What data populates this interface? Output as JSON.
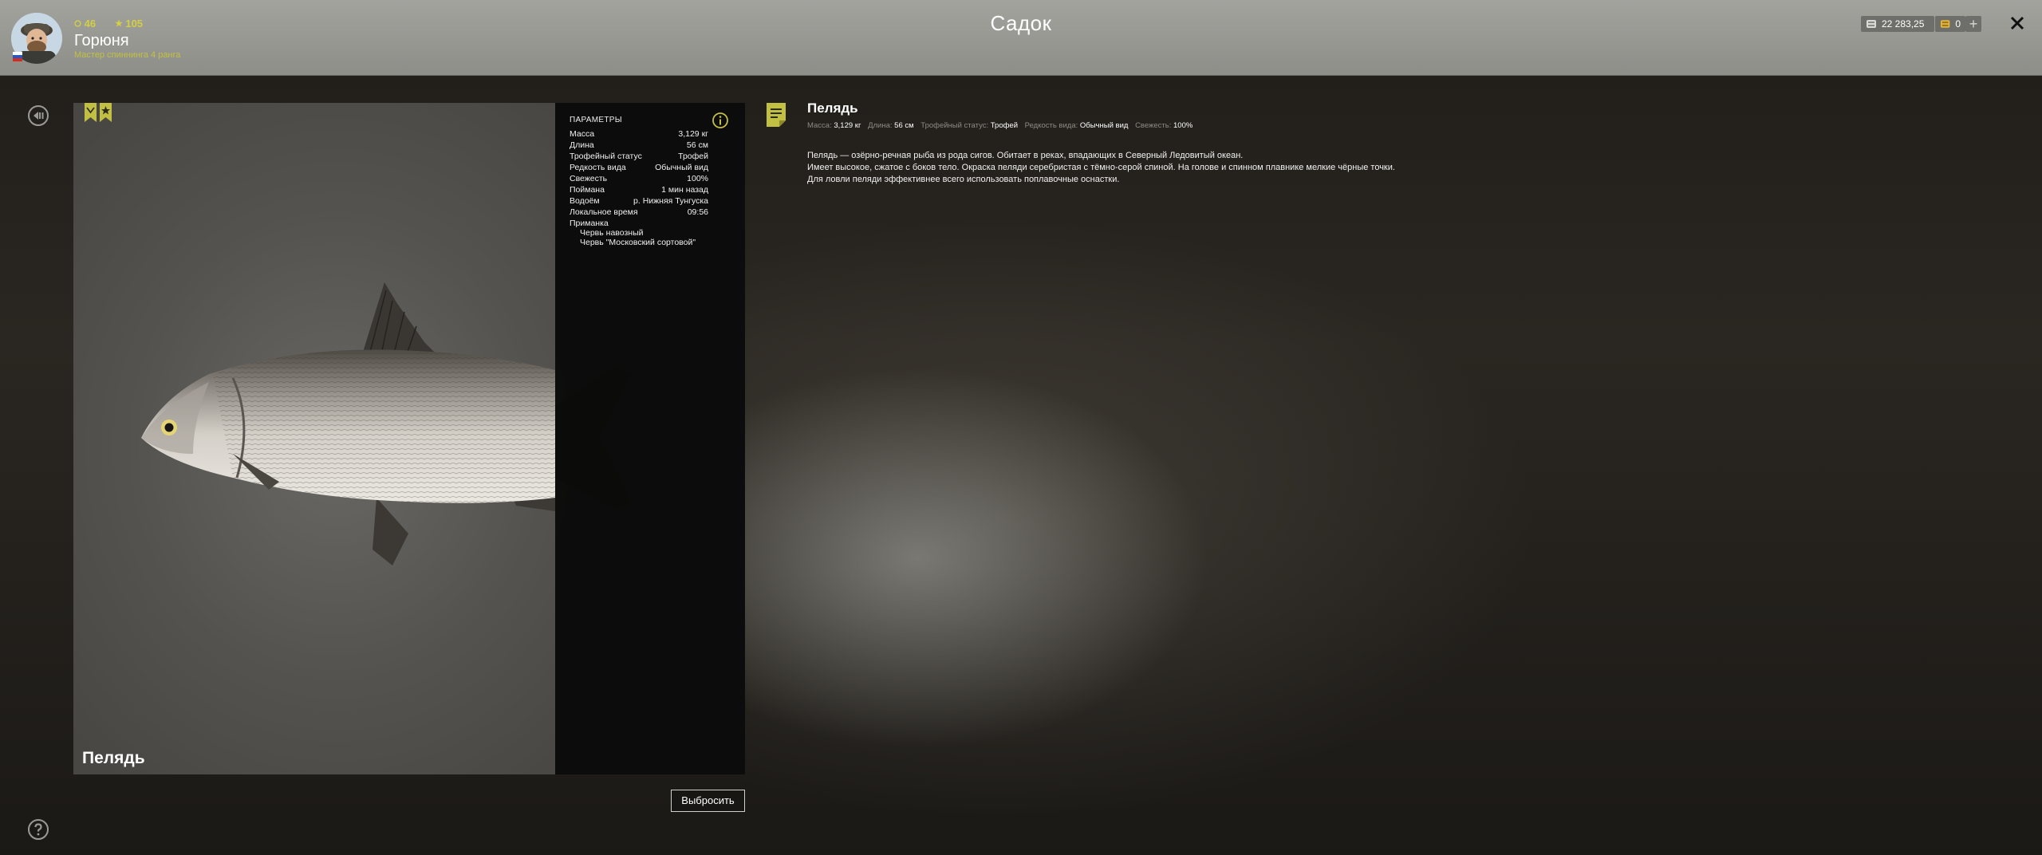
{
  "header": {
    "title": "Садок",
    "player": {
      "name": "Горюня",
      "rank": "Мастер спиннинга 4 ранга",
      "level": "46",
      "stars": "105"
    },
    "currency": {
      "silver": "22 283,25",
      "gold": "0"
    }
  },
  "fish": {
    "name": "Пелядь",
    "params_title": "ПАРАМЕТРЫ",
    "params": [
      {
        "label": "Масса",
        "value": "3,129 кг"
      },
      {
        "label": "Длина",
        "value": "56 см"
      },
      {
        "label": "Трофейный статус",
        "value": "Трофей"
      },
      {
        "label": "Редкость вида",
        "value": "Обычный вид"
      },
      {
        "label": "Свежесть",
        "value": "100%"
      },
      {
        "label": "Поймана",
        "value": "1 мин назад"
      },
      {
        "label": "Водоём",
        "value": "р. Нижняя Тунгуска"
      },
      {
        "label": "Локальное время",
        "value": "09:56"
      }
    ],
    "bait_label": "Приманка",
    "baits": [
      "Червь навозный",
      "Червь \"Московский сортовой\""
    ],
    "discard_label": "Выбросить"
  },
  "description": {
    "title": "Пелядь",
    "meta": [
      {
        "key": "Масса:",
        "value": "3,129 кг"
      },
      {
        "key": "Длина:",
        "value": "56 см"
      },
      {
        "key": "Трофейный статус:",
        "value": "Трофей"
      },
      {
        "key": "Редкость вида:",
        "value": "Обычный вид"
      },
      {
        "key": "Свежесть:",
        "value": "100%"
      }
    ],
    "lines": [
      "Пелядь — озёрно-речная рыба из рода сигов. Обитает в реках, впадающих в Северный Ледовитый океан.",
      "Имеет высокое, сжатое с боков тело. Окраска пеляди серебристая с тёмно-серой спиной. На голове и спинном плавнике мелкие чёрные точки.",
      "Для ловли пеляди эффективнее всего использовать поплавочные оснастки."
    ]
  },
  "icons": {
    "avatar": "fisherman-avatar-icon",
    "flag": "russia-flag-icon",
    "level": "level-circle-icon",
    "stars": "star-icon",
    "silver": "silver-coins-icon",
    "gold": "gold-coins-icon",
    "add": "plus-icon",
    "close": "close-icon",
    "back": "back-arrow-icon",
    "help": "help-icon",
    "trophy": "trophy-ribbon-icon",
    "info": "info-icon",
    "note": "note-icon"
  },
  "colors": {
    "accent": "#c2c042",
    "header": "#9b9b96",
    "panel": "#0b0b0b"
  }
}
